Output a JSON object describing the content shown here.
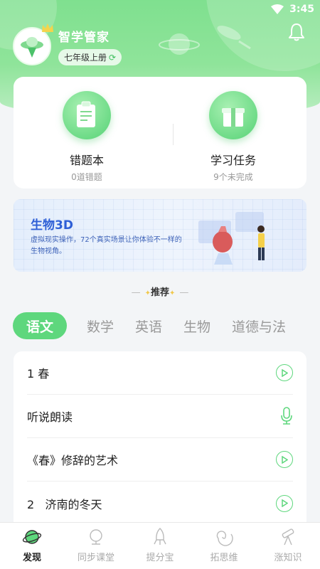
{
  "status": {
    "time": "3:45"
  },
  "header": {
    "app_name": "智学管家",
    "grade": "七年级上册"
  },
  "cards": [
    {
      "title": "错题本",
      "subtitle": "0道错题"
    },
    {
      "title": "学习任务",
      "subtitle": "9个未完成"
    }
  ],
  "banner": {
    "title": "生物3D",
    "description": "虚拟现实操作，72个真实场景让你体验不一样的生物视角。"
  },
  "recommend": {
    "label": "推荐"
  },
  "tabs": [
    {
      "label": "语文",
      "active": true
    },
    {
      "label": "数学"
    },
    {
      "label": "英语"
    },
    {
      "label": "生物"
    },
    {
      "label": "道德与法"
    }
  ],
  "list": [
    {
      "label": "1  春",
      "icon": "play-icon"
    },
    {
      "label": "听说朗读",
      "icon": "microphone-icon"
    },
    {
      "label": "《春》修辞的艺术",
      "icon": "play-icon"
    },
    {
      "label": "2   济南的冬天",
      "icon": "play-icon"
    }
  ],
  "nav": [
    {
      "label": "发现",
      "icon": "planet-icon",
      "active": true
    },
    {
      "label": "同步课堂",
      "icon": "globe-icon"
    },
    {
      "label": "提分宝",
      "icon": "rocket-icon"
    },
    {
      "label": "拓思维",
      "icon": "galaxy-icon"
    },
    {
      "label": "涨知识",
      "icon": "telescope-icon"
    }
  ],
  "colors": {
    "accent": "#5ed77d",
    "banner_text": "#2e5fd6"
  }
}
